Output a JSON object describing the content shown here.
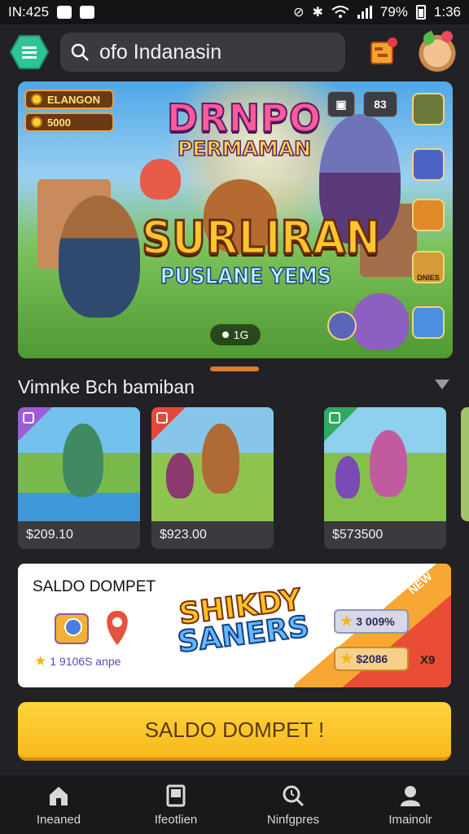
{
  "status_bar": {
    "left_text": "IN:425",
    "battery_percent": "79%",
    "time": "1:36"
  },
  "header": {
    "search_text": "ofo Indanasin"
  },
  "banner": {
    "currency_label": "ELANGON",
    "coin_value": "5000",
    "logo_title": "DRNPO",
    "logo_subtitle": "PERMAMAN",
    "main_title": "SURLIRAN",
    "main_subtitle": "PUSLANE YEMS",
    "top_count": "83",
    "side_label": "DNIES",
    "pager_text": "1G"
  },
  "section": {
    "title": "Vimnke Bch bamiban"
  },
  "cards": [
    {
      "price": "$209.10",
      "tag_color": "#9c5cd8"
    },
    {
      "price": "$923.00",
      "tag_color": "#e8463a"
    },
    {
      "price": "$573500",
      "tag_color": "#2eab63"
    }
  ],
  "wallet": {
    "title": "SALDO DOMPET",
    "stat_text": "1 9106S anpe",
    "logo_line1": "SHIKDY",
    "logo_line2": "SANERS",
    "pill_1": "3 009%",
    "pill_2": "$2086",
    "corner_badge": "X9",
    "ribbon_text": "NEW"
  },
  "cta": {
    "label": "SALDO DOMPET !"
  },
  "bottom_nav": {
    "items": [
      {
        "label": "Ineaned",
        "icon": "home-icon"
      },
      {
        "label": "Ifeotlien",
        "icon": "book-icon"
      },
      {
        "label": "Ninfgpres",
        "icon": "search-clock-icon"
      },
      {
        "label": "Imainolr",
        "icon": "person-icon"
      }
    ]
  },
  "colors": {
    "accent": "#f7b81c",
    "background": "#222226",
    "menu_button": "#2fc39a"
  }
}
